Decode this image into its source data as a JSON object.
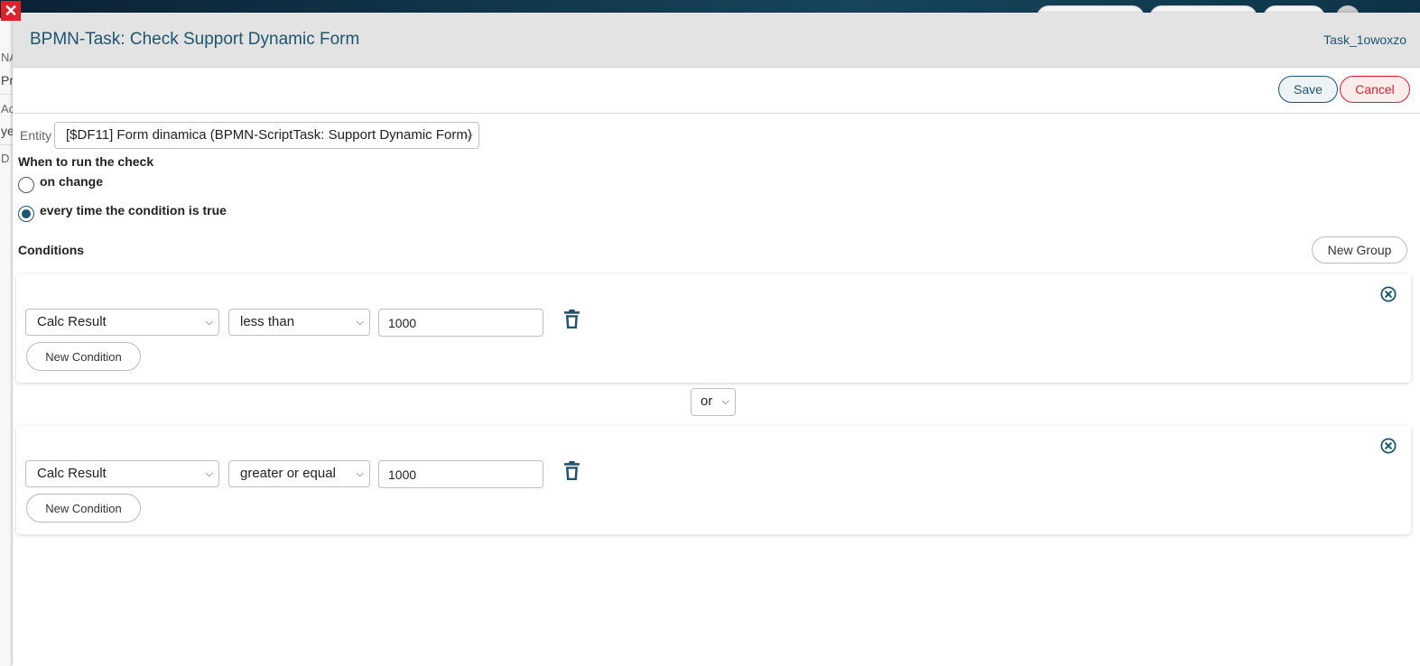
{
  "background": {
    "left_fragments": [
      "NA",
      "Pr",
      "Ac",
      "ye",
      "D"
    ]
  },
  "modal": {
    "title": "BPMN-Task: Check Support Dynamic Form",
    "task_id": "Task_1owoxzo",
    "save_label": "Save",
    "cancel_label": "Cancel"
  },
  "form": {
    "entity_label": "Entity",
    "entity_value": "[$DF11] Form dinamica (BPMN-ScriptTask: Support Dynamic Form)",
    "when_label": "When to run the check",
    "radio_options": [
      {
        "label": "on change",
        "checked": false
      },
      {
        "label": "every time the condition is true",
        "checked": true
      }
    ],
    "conditions_label": "Conditions",
    "new_group_label": "New Group"
  },
  "groups": [
    {
      "conditions": [
        {
          "field": "Calc Result",
          "operator": "less than",
          "value": "1000"
        }
      ],
      "new_condition_label": "New Condition"
    },
    {
      "conditions": [
        {
          "field": "Calc Result",
          "operator": "greater or equal",
          "value": "1000"
        }
      ],
      "new_condition_label": "New Condition"
    }
  ],
  "group_join": "or",
  "colors": {
    "accent": "#1d5470",
    "danger": "#e0202a"
  }
}
